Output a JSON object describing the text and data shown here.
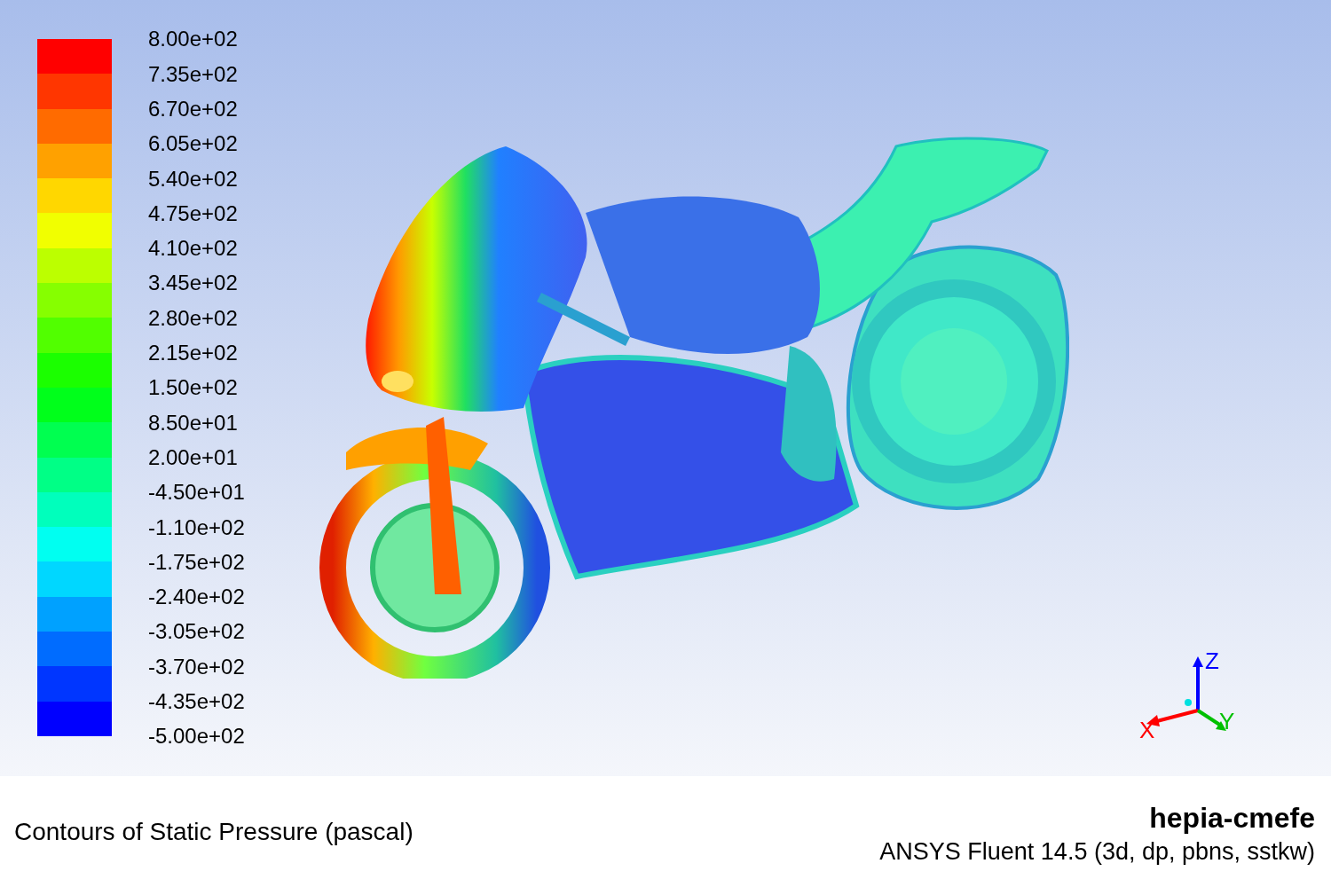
{
  "legend": {
    "bands": [
      {
        "color": "#ff0000"
      },
      {
        "color": "#ff3600"
      },
      {
        "color": "#ff6b00"
      },
      {
        "color": "#ffa100"
      },
      {
        "color": "#ffd700"
      },
      {
        "color": "#f1ff00"
      },
      {
        "color": "#bcff00"
      },
      {
        "color": "#86ff00"
      },
      {
        "color": "#51ff00"
      },
      {
        "color": "#1bff00"
      },
      {
        "color": "#00ff1b"
      },
      {
        "color": "#00ff50"
      },
      {
        "color": "#00ff86"
      },
      {
        "color": "#00ffbc"
      },
      {
        "color": "#00fff1"
      },
      {
        "color": "#00d7ff"
      },
      {
        "color": "#00a1ff"
      },
      {
        "color": "#006cff"
      },
      {
        "color": "#0036ff"
      },
      {
        "color": "#0000ff"
      }
    ],
    "labels": [
      "8.00e+02",
      "7.35e+02",
      "6.70e+02",
      "6.05e+02",
      "5.40e+02",
      "4.75e+02",
      "4.10e+02",
      "3.45e+02",
      "2.80e+02",
      "2.15e+02",
      "1.50e+02",
      "8.50e+01",
      "2.00e+01",
      "-4.50e+01",
      "-1.10e+02",
      "-1.75e+02",
      "-2.40e+02",
      "-3.05e+02",
      "-3.70e+02",
      "-4.35e+02",
      "-5.00e+02"
    ]
  },
  "triad": {
    "x_label": "X",
    "y_label": "Y",
    "z_label": "Z"
  },
  "footer": {
    "caption": "Contours of Static Pressure (pascal)",
    "title": "hepia-cmefe",
    "version": "ANSYS Fluent 14.5 (3d, dp, pbns, sstkw)"
  }
}
